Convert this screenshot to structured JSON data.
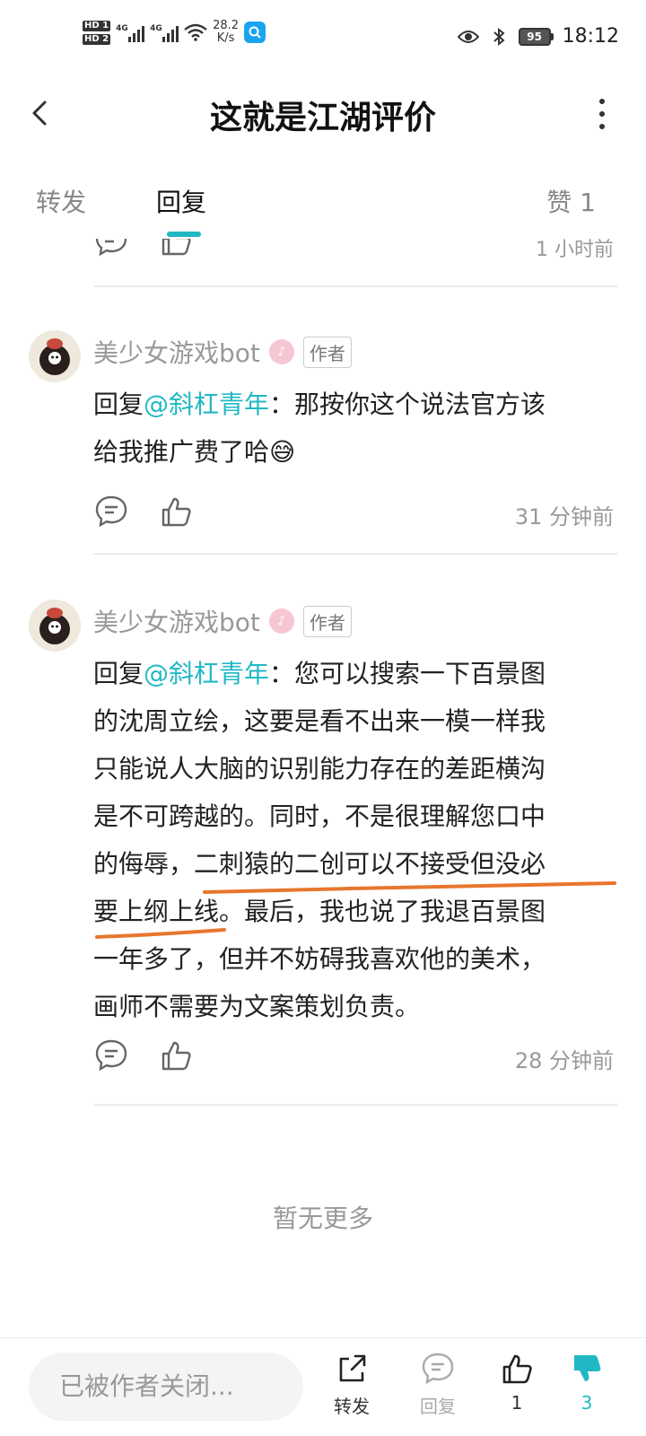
{
  "status_bar": {
    "hd1": "HD 1",
    "hd2": "HD 2",
    "net1": "4G",
    "net2": "4G",
    "speed_value": "28.2",
    "speed_unit": "K/s",
    "battery": "95",
    "time": "18:12"
  },
  "header": {
    "title": "这就是江湖评价"
  },
  "tabs": {
    "repost": "转发",
    "reply": "回复",
    "like": "赞 1"
  },
  "partial_comment": {
    "time": "1 小时前"
  },
  "comments": [
    {
      "name": "美少女游戏bot",
      "author_tag": "作者",
      "reply_prefix": "回复",
      "mention": "@斜杠青年",
      "text_lines": [
        "：那按你这个说法官方该",
        "给我推广费了哈😅"
      ],
      "time": "31 分钟前"
    },
    {
      "name": "美少女游戏bot",
      "author_tag": "作者",
      "reply_prefix": "回复",
      "mention": "@斜杠青年",
      "text_lines": [
        "：您可以搜索一下百景图",
        "的沈周立绘，这要是看不出来一模一样我",
        "只能说人大脑的识别能力存在的差距横沟",
        "是不可跨越的。同时，不是很理解您口中",
        "的侮辱，二刺猿的二创可以不接受但没必",
        "要上纲上线。最后，我也说了我退百景图",
        "一年多了，但并不妨碍我喜欢他的美术，",
        "画师不需要为文案策划负责。"
      ],
      "time": "28 分钟前"
    }
  ],
  "no_more": "暂无更多",
  "bottom_bar": {
    "input_placeholder": "已被作者关闭...",
    "repost": "转发",
    "reply": "回复",
    "like_count": "1",
    "dislike_count": "3"
  },
  "colors": {
    "accent": "#21b8c4",
    "underline_annotation": "#e8762c",
    "muted": "#999999"
  }
}
